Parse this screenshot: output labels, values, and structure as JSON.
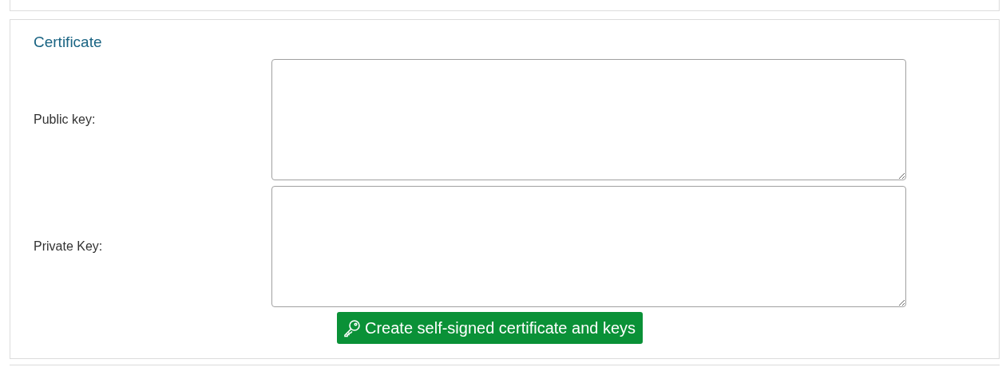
{
  "section": {
    "title": "Certificate"
  },
  "fields": [
    {
      "label": "Public key:"
    },
    {
      "label": "Private Key:"
    }
  ],
  "button": {
    "label": "Create self-signed certificate and keys"
  }
}
